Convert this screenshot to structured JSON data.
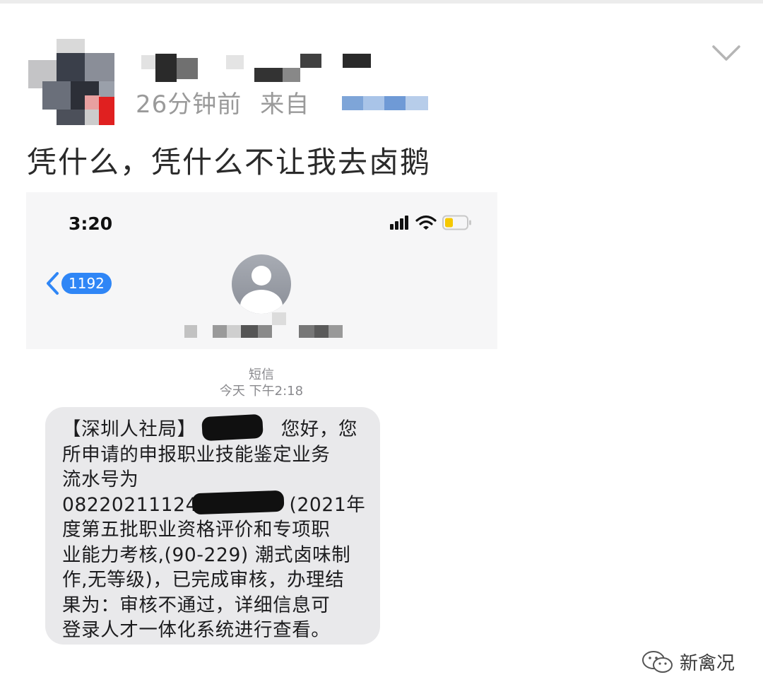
{
  "post": {
    "time_ago": "26分钟前",
    "from_label": "来自",
    "text": "凭什么，凭什么不让我去卤鹅"
  },
  "phone": {
    "status_time": "3:20",
    "back_count": "1192",
    "sms_label": "短信",
    "sms_time": "今天 下午2:18",
    "message_lines": [
      "【深圳人社局】",
      "所申请的申报职业技能鉴定业务",
      "流水号为",
      "082202111240",
      "度第五批职业资格评价和专项职",
      "业能力考核,(90-229) 潮式卤味制",
      "作,无等级)，已完成审核，办理结",
      "果为：审核不通过，详细信息可",
      "登录人才一体化系统进行查看。"
    ],
    "line1_tail": "您好，您",
    "line4_tail": "(2021年"
  },
  "watermark": {
    "text": "新禽况"
  }
}
